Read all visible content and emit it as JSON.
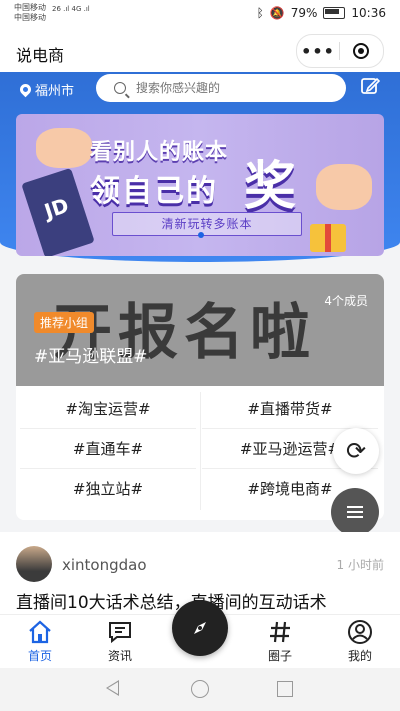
{
  "status_bar": {
    "carrier1": "中国移动",
    "carrier2": "中国移动",
    "net1": "26 .ıl",
    "net2": "4G .ıl",
    "battery": "79%",
    "time": "10:36"
  },
  "header": {
    "title": "说电商",
    "more_label": "•••"
  },
  "location": {
    "city": "福州市"
  },
  "search": {
    "placeholder": "搜索你感兴趣的"
  },
  "banner": {
    "line1": "看别人的账本",
    "line2": "领自己的",
    "big_char": "奖",
    "subtitle": "清新玩转多账本",
    "card_text": "JD"
  },
  "group": {
    "background_text": "开报名啦",
    "tag": "推荐小组",
    "members": "4个成员",
    "name": "#亚马逊联盟#",
    "topics": [
      "#淘宝运营#",
      "#直播带货#",
      "#直通车#",
      "#亚马逊运营#",
      "#独立站#",
      "#跨境电商#"
    ]
  },
  "post": {
    "author": "xintongdao",
    "time": "1 小时前",
    "title": "直播间10大话术总结，直播间的互动话术"
  },
  "tabs": [
    "首页",
    "资讯",
    "圈子",
    "我的"
  ],
  "colors": {
    "primary_blue": "#3478e5",
    "tag_orange": "#f08a2b"
  }
}
